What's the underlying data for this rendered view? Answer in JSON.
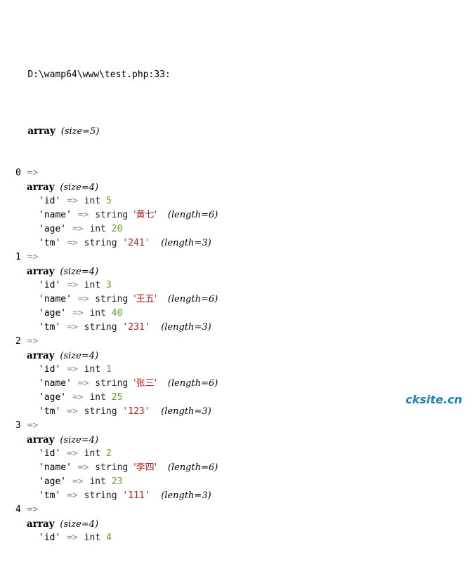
{
  "output": {
    "source_path": "D:\\wamp64\\www\\test.php:33:",
    "root": {
      "keyword": "array",
      "meta": "(size=5)"
    },
    "arrow": "=>",
    "type_labels": {
      "int": "int",
      "string": "string"
    },
    "child_keyword": "array",
    "child_meta": "(size=4)",
    "entries": [
      {
        "index": "0",
        "fields": [
          {
            "key": "'id'",
            "type": "int",
            "value": "5",
            "meta": ""
          },
          {
            "key": "'name'",
            "type": "string",
            "value": "'黄七'",
            "meta": "(length=6)"
          },
          {
            "key": "'age'",
            "type": "int",
            "value": "20",
            "meta": ""
          },
          {
            "key": "'tm'",
            "type": "string",
            "value": "'241'",
            "meta": "(length=3)"
          }
        ]
      },
      {
        "index": "1",
        "fields": [
          {
            "key": "'id'",
            "type": "int",
            "value": "3",
            "meta": ""
          },
          {
            "key": "'name'",
            "type": "string",
            "value": "'王五'",
            "meta": "(length=6)"
          },
          {
            "key": "'age'",
            "type": "int",
            "value": "40",
            "meta": ""
          },
          {
            "key": "'tm'",
            "type": "string",
            "value": "'231'",
            "meta": "(length=3)"
          }
        ]
      },
      {
        "index": "2",
        "fields": [
          {
            "key": "'id'",
            "type": "int",
            "value": "1",
            "meta": ""
          },
          {
            "key": "'name'",
            "type": "string",
            "value": "'张三'",
            "meta": "(length=6)"
          },
          {
            "key": "'age'",
            "type": "int",
            "value": "25",
            "meta": ""
          },
          {
            "key": "'tm'",
            "type": "string",
            "value": "'123'",
            "meta": "(length=3)"
          }
        ]
      },
      {
        "index": "3",
        "fields": [
          {
            "key": "'id'",
            "type": "int",
            "value": "2",
            "meta": ""
          },
          {
            "key": "'name'",
            "type": "string",
            "value": "'李四'",
            "meta": "(length=6)"
          },
          {
            "key": "'age'",
            "type": "int",
            "value": "23",
            "meta": ""
          },
          {
            "key": "'tm'",
            "type": "string",
            "value": "'111'",
            "meta": "(length=3)"
          }
        ]
      },
      {
        "index": "4",
        "fields": [
          {
            "key": "'id'",
            "type": "int",
            "value": "4",
            "meta": ""
          }
        ]
      }
    ]
  },
  "watermark": {
    "text": "cksite.cn",
    "color": "#1a80b8"
  },
  "colors": {
    "int_value": "#6a9a3a",
    "string_value": "#aa2222",
    "arrow": "#8a8a8a",
    "text": "#000000",
    "background": "#ffffff"
  }
}
